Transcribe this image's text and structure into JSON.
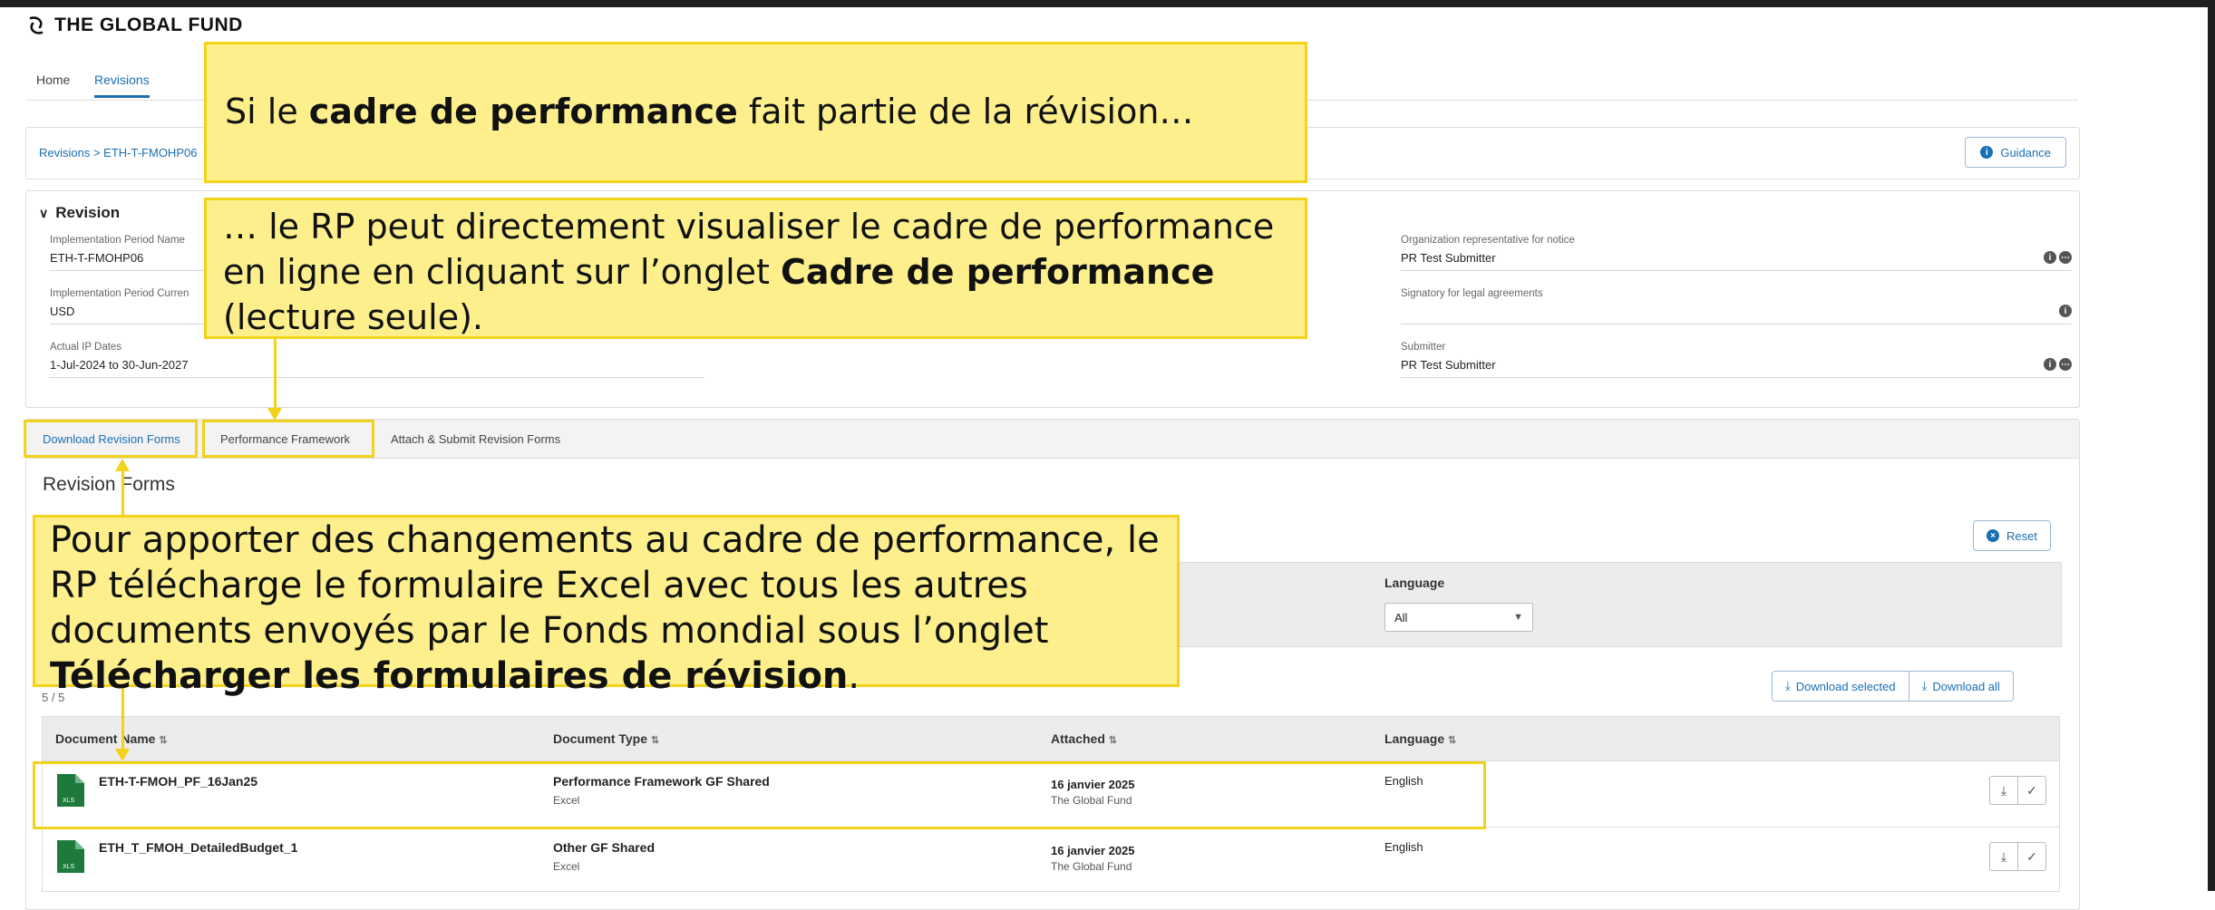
{
  "brand": {
    "name": "THE GLOBAL FUND"
  },
  "nav": {
    "items": [
      "Home",
      "Revisions"
    ],
    "active": "Revisions"
  },
  "breadcrumb": {
    "text": "Revisions > ETH-T-FMOHP06"
  },
  "guidance": {
    "label": "Guidance"
  },
  "revision": {
    "title": "Revision",
    "fields": [
      {
        "label": "Implementation Period Name",
        "value": "ETH-T-FMOHP06"
      },
      {
        "label": "Implementation Period Curren",
        "value": "USD"
      },
      {
        "label": "Actual IP Dates",
        "value": "1-Jul-2024 to 30-Jun-2027"
      }
    ],
    "right_fields": [
      {
        "label": "Organization representative for notice",
        "value": "PR Test Submitter"
      },
      {
        "label": "Signatory for legal agreements",
        "value": ""
      },
      {
        "label": "Submitter",
        "value": "PR Test Submitter"
      }
    ]
  },
  "tabs": [
    "Download Revision Forms",
    "Performance Framework",
    "Attach & Submit Revision Forms"
  ],
  "section_title": "Revision Forms",
  "reset": {
    "label": "Reset"
  },
  "filters": {
    "language_label": "Language",
    "language_value": "All"
  },
  "count": "5 / 5",
  "download": {
    "selected": "Download selected",
    "all": "Download all"
  },
  "table": {
    "headers": [
      "Document Name",
      "Document Type",
      "Attached",
      "Language"
    ],
    "rows": [
      {
        "name": "ETH-T-FMOH_PF_16Jan25",
        "type": "Performance Framework GF Shared",
        "format": "Excel",
        "date": "16 janvier 2025",
        "by": "The Global Fund",
        "language": "English"
      },
      {
        "name": "ETH_T_FMOH_DetailedBudget_1",
        "type": "Other GF Shared",
        "format": "Excel",
        "date": "16 janvier 2025",
        "by": "The Global Fund",
        "language": "English"
      }
    ]
  },
  "callouts": {
    "c1_pre": "Si le ",
    "c1_bold": "cadre de performance",
    "c1_post": " fait partie de la révision…",
    "c2_line1": "… le RP peut directement visualiser le cadre de performance",
    "c2_line2_pre": "en ligne en cliquant sur l’onglet ",
    "c2_line2_bold": "Cadre de performance",
    "c2_line3": "(lecture seule).",
    "c3_line1": "Pour apporter des changements au cadre de performance, le",
    "c3_line2": "RP télécharge le formulaire Excel avec tous les autres",
    "c3_line3": "documents envoyés par le Fonds mondial sous l’onglet",
    "c3_bold": "Télécharger les formulaires de révision",
    "c3_end": "."
  },
  "colors": {
    "accent": "#1a6fb3",
    "callout_bg": "#fdf08c",
    "callout_border": "#f2d21a",
    "excel_green": "#1e7a3c"
  }
}
